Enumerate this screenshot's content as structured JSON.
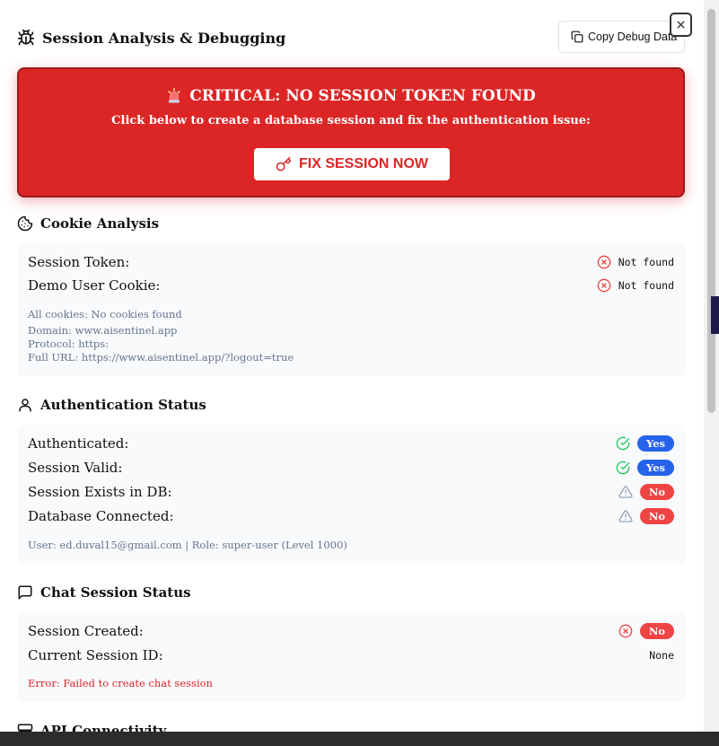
{
  "header": {
    "title": "Session Analysis & Debugging",
    "copy_button": "Copy Debug Data"
  },
  "alert": {
    "title": "CRITICAL: NO SESSION TOKEN FOUND",
    "subtitle": "Click below to create a database session and fix the authentication issue:",
    "button": "FIX SESSION NOW"
  },
  "cookie_analysis": {
    "title": "Cookie Analysis",
    "rows": [
      {
        "label": "Session Token:",
        "value": "Not found"
      },
      {
        "label": "Demo User Cookie:",
        "value": "Not found"
      }
    ],
    "all_cookies": "All cookies: No cookies found",
    "domain": "Domain: www.aisentinel.app",
    "protocol": "Protocol: https:",
    "full_url": "Full URL: https://www.aisentinel.app/?logout=true"
  },
  "auth_status": {
    "title": "Authentication Status",
    "rows": [
      {
        "label": "Authenticated:",
        "value": "Yes"
      },
      {
        "label": "Session Valid:",
        "value": "Yes"
      },
      {
        "label": "Session Exists in DB:",
        "value": "No"
      },
      {
        "label": "Database Connected:",
        "value": "No"
      }
    ],
    "user_info": "User: ed.duval15@gmail.com | Role: super-user (Level 1000)"
  },
  "chat_session": {
    "title": "Chat Session Status",
    "rows": [
      {
        "label": "Session Created:",
        "value": "No"
      },
      {
        "label": "Current Session ID:",
        "value": "None"
      }
    ],
    "error": "Error: Failed to create chat session"
  },
  "api": {
    "title": "API Connectivity"
  },
  "colors": {
    "danger": "#dc2626",
    "primary": "#2563eb",
    "success": "#22c55e",
    "warning_icon": "#94a3b8"
  }
}
